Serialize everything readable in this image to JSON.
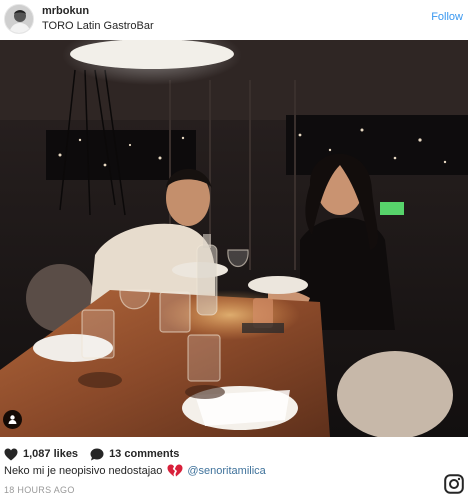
{
  "post": {
    "username": "mrbokun",
    "location": "TORO Latin GastroBar",
    "follow_label": "Follow",
    "likes": "1,087 likes",
    "comments": "13 comments",
    "caption": "Neko mi je neopisivo nedostajao",
    "mention": "@senoritamilica",
    "timestamp": "18 HOURS AGO"
  },
  "icons": {
    "like": "heart-icon",
    "comment": "speech-bubble-icon",
    "tag": "user-tag-icon",
    "caption_emoji": "broken-heart-icon",
    "logo": "instagram-logo-icon"
  },
  "colors": {
    "link": "#3897f0",
    "mention": "#3f729b",
    "muted": "#999999",
    "emoji_red": "#d8203a"
  }
}
